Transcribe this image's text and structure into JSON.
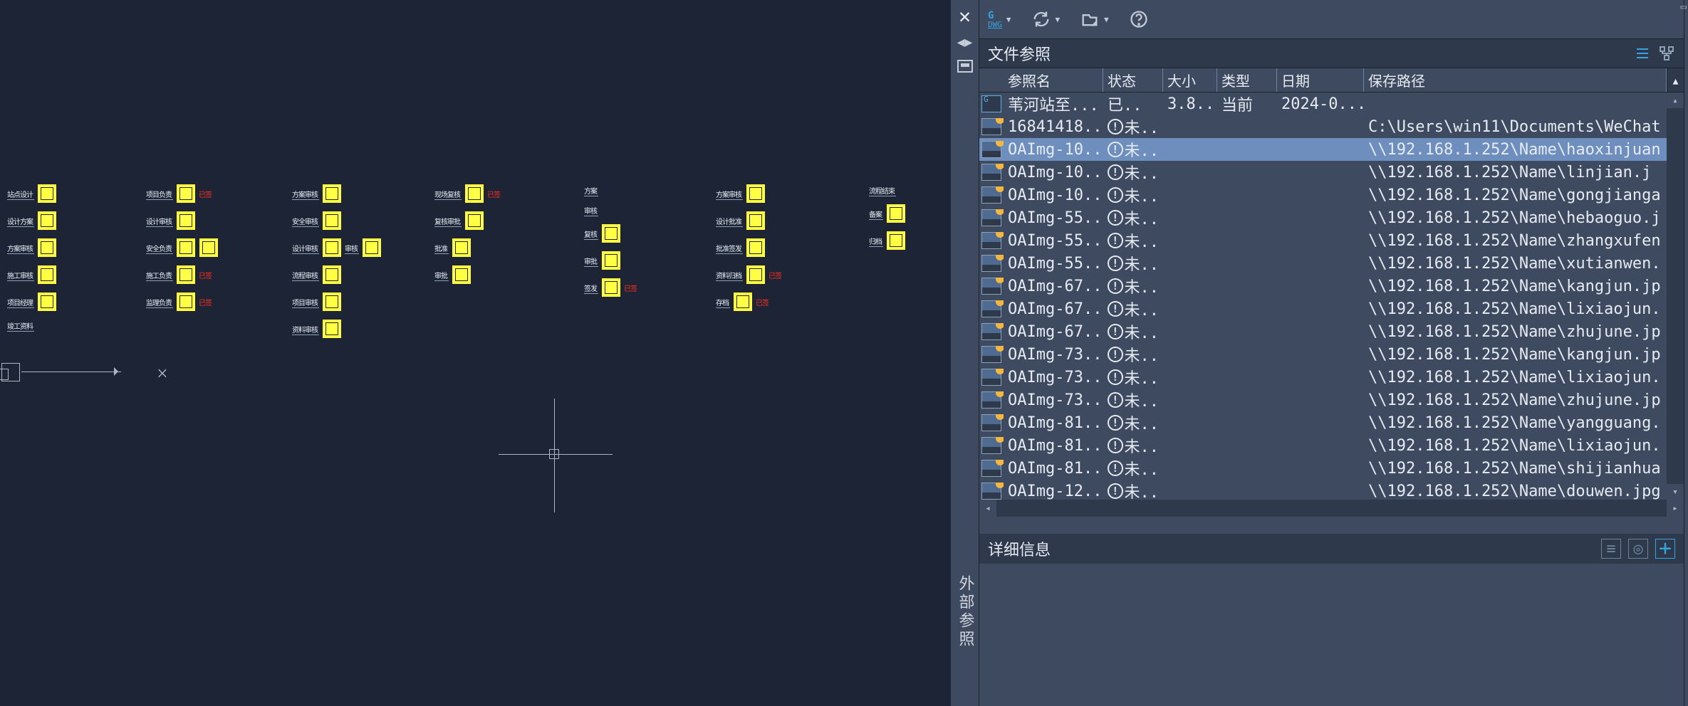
{
  "spine": {
    "vtext": "外部参照"
  },
  "toolbar": {
    "dwg_top": "G",
    "dwg_bot": "DWG"
  },
  "section_refs": {
    "title": "文件参照",
    "columns": {
      "name": "参照名",
      "status": "状态",
      "size": "大小",
      "type": "类型",
      "date": "日期",
      "path": "保存路径"
    }
  },
  "rows": [
    {
      "icon": "dwg",
      "name": "苇河站至...",
      "status_icon": false,
      "status": "已..",
      "size": "3.8...",
      "type": "当前",
      "date": "2024-0...",
      "path": "",
      "selected": false
    },
    {
      "icon": "img",
      "name": "16841418...",
      "status_icon": true,
      "status": "未..",
      "size": "",
      "type": "",
      "date": "",
      "path": "C:\\Users\\win11\\Documents\\WeChat",
      "selected": false
    },
    {
      "icon": "img",
      "name": "OAImg-10...",
      "status_icon": true,
      "status": "未..",
      "size": "",
      "type": "",
      "date": "",
      "path": "\\\\192.168.1.252\\Name\\haoxinjuan",
      "selected": true
    },
    {
      "icon": "img",
      "name": "OAImg-10...",
      "status_icon": true,
      "status": "未..",
      "size": "",
      "type": "",
      "date": "",
      "path": "\\\\192.168.1.252\\Name\\linjian.j",
      "selected": false
    },
    {
      "icon": "img",
      "name": "OAImg-10...",
      "status_icon": true,
      "status": "未..",
      "size": "",
      "type": "",
      "date": "",
      "path": "\\\\192.168.1.252\\Name\\gongjianga",
      "selected": false
    },
    {
      "icon": "img",
      "name": "OAImg-55...",
      "status_icon": true,
      "status": "未..",
      "size": "",
      "type": "",
      "date": "",
      "path": "\\\\192.168.1.252\\Name\\hebaoguo.j",
      "selected": false
    },
    {
      "icon": "img",
      "name": "OAImg-55...",
      "status_icon": true,
      "status": "未..",
      "size": "",
      "type": "",
      "date": "",
      "path": "\\\\192.168.1.252\\Name\\zhangxufen",
      "selected": false
    },
    {
      "icon": "img",
      "name": "OAImg-55...",
      "status_icon": true,
      "status": "未..",
      "size": "",
      "type": "",
      "date": "",
      "path": "\\\\192.168.1.252\\Name\\xutianwen.",
      "selected": false
    },
    {
      "icon": "img",
      "name": "OAImg-67...",
      "status_icon": true,
      "status": "未..",
      "size": "",
      "type": "",
      "date": "",
      "path": "\\\\192.168.1.252\\Name\\kangjun.jp",
      "selected": false
    },
    {
      "icon": "img",
      "name": "OAImg-67...",
      "status_icon": true,
      "status": "未..",
      "size": "",
      "type": "",
      "date": "",
      "path": "\\\\192.168.1.252\\Name\\lixiaojun.",
      "selected": false
    },
    {
      "icon": "img",
      "name": "OAImg-67...",
      "status_icon": true,
      "status": "未..",
      "size": "",
      "type": "",
      "date": "",
      "path": "\\\\192.168.1.252\\Name\\zhujune.jp",
      "selected": false
    },
    {
      "icon": "img",
      "name": "OAImg-73...",
      "status_icon": true,
      "status": "未..",
      "size": "",
      "type": "",
      "date": "",
      "path": "\\\\192.168.1.252\\Name\\kangjun.jp",
      "selected": false
    },
    {
      "icon": "img",
      "name": "OAImg-73...",
      "status_icon": true,
      "status": "未..",
      "size": "",
      "type": "",
      "date": "",
      "path": "\\\\192.168.1.252\\Name\\lixiaojun.",
      "selected": false
    },
    {
      "icon": "img",
      "name": "OAImg-73...",
      "status_icon": true,
      "status": "未..",
      "size": "",
      "type": "",
      "date": "",
      "path": "\\\\192.168.1.252\\Name\\zhujune.jp",
      "selected": false
    },
    {
      "icon": "img",
      "name": "OAImg-81...",
      "status_icon": true,
      "status": "未..",
      "size": "",
      "type": "",
      "date": "",
      "path": "\\\\192.168.1.252\\Name\\yangguang.",
      "selected": false
    },
    {
      "icon": "img",
      "name": "OAImg-81...",
      "status_icon": true,
      "status": "未..",
      "size": "",
      "type": "",
      "date": "",
      "path": "\\\\192.168.1.252\\Name\\lixiaojun.",
      "selected": false
    },
    {
      "icon": "img",
      "name": "OAImg-81...",
      "status_icon": true,
      "status": "未..",
      "size": "",
      "type": "",
      "date": "",
      "path": "\\\\192.168.1.252\\Name\\shijianhua",
      "selected": false
    },
    {
      "icon": "img",
      "name": "OAImg-12...",
      "status_icon": true,
      "status": "未..",
      "size": "",
      "type": "",
      "date": "",
      "path": "\\\\192.168.1.252\\Name\\douwen.jpg",
      "selected": false
    }
  ],
  "details": {
    "title": "详细信息"
  }
}
